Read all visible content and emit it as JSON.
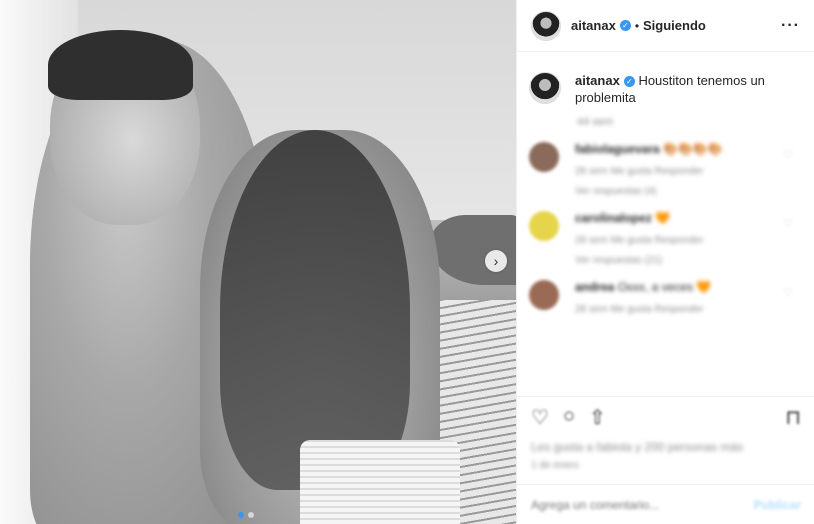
{
  "post": {
    "username": "aitanax",
    "follow_status": "Siguiendo",
    "separator": "•",
    "more_icon": "more-horizontal-icon"
  },
  "caption": {
    "username": "aitanax",
    "text": "Houstiton tenemos un problemita"
  },
  "comments_blurred": {
    "top_time": "44 sem",
    "items": [
      {
        "username": "fabiolaguevara",
        "text": "🎨🎨🎨🎨",
        "meta": "28 sem  Me gusta  Responder",
        "replies": "Ver respuestas (4)",
        "avatar_color": "#8a6a5a"
      },
      {
        "username": "carolinalopez",
        "text": "🧡",
        "meta": "28 sem  Me gusta  Responder",
        "replies": "Ver respuestas (21)",
        "avatar_color": "#e6d44a"
      },
      {
        "username": "andrea",
        "text": "Oxxx, a veces 🧡",
        "meta": "28 sem  Me gusta  Responder",
        "replies": "",
        "avatar_color": "#9a6a55"
      }
    ]
  },
  "actions": {
    "likes_text": "Les gusta a fabiola y 200 personas más",
    "date_text": "1 de enero"
  },
  "add_comment": {
    "placeholder": "Agrega un comentario...",
    "publish_label": "Publicar"
  },
  "colors": {
    "verified": "#3897f0",
    "border": "#efefef",
    "publish": "#b2dffc"
  }
}
